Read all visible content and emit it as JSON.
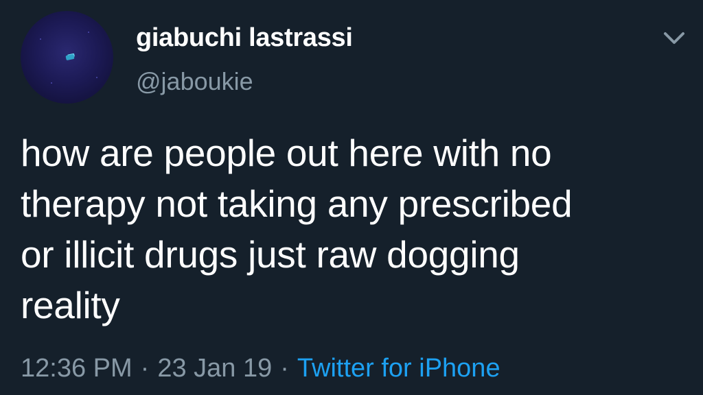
{
  "tweet": {
    "author": {
      "display_name": "giabuchi lastrassi",
      "handle": "@jaboukie",
      "avatar_icon": "avatar-image"
    },
    "text": "how are people out here with no\ntherapy not taking any prescribed\nor illicit drugs just raw dogging\nreality",
    "time": "12:36 PM",
    "date": "23 Jan 19",
    "separator": "·",
    "source": "Twitter for iPhone",
    "menu_icon": "chevron-down-icon"
  },
  "colors": {
    "background": "#15202b",
    "text_primary": "#ffffff",
    "text_secondary": "#8899a6",
    "accent": "#1da1f2"
  }
}
